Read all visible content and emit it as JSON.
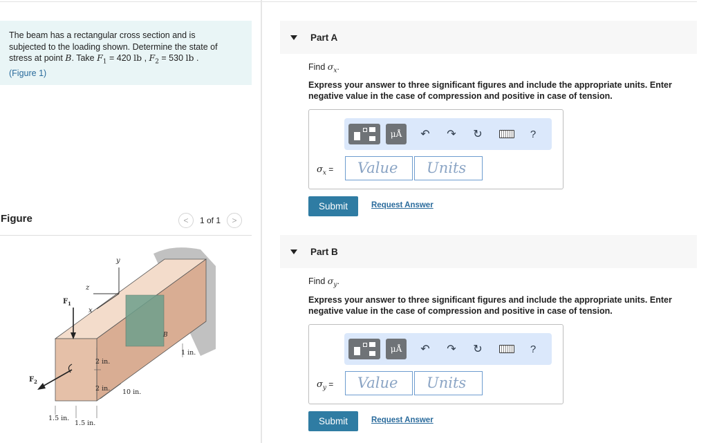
{
  "problem": {
    "line1": "The beam has a rectangular cross section and is",
    "line2": "subjected to the loading shown. Determine the state of",
    "line3_pre": "stress at point ",
    "point": "B",
    "line3_take": ". Take ",
    "f1_sym": "F",
    "f1_sub": "1",
    "f1_val": " = 420 ",
    "f1_unit": "lb",
    "comma": " , ",
    "f2_sym": "F",
    "f2_sub": "2",
    "f2_val": " = 530 ",
    "f2_unit": "lb",
    "period": " .",
    "figure_link": "(Figure 1)"
  },
  "figure_panel": {
    "title": "Figure",
    "prev": "<",
    "counter": "1 of 1",
    "next": ">"
  },
  "figure_labels": {
    "y": "y",
    "z": "z",
    "x": "x",
    "F1": "F",
    "F1_sub": "1",
    "F2": "F",
    "F2_sub": "2",
    "B": "B",
    "one_in": "1 in.",
    "two_in_a": "2 in.",
    "two_in_b": "2 in.",
    "ten_in": "10 in.",
    "one_five_a": "1.5 in.",
    "one_five_b": "1.5 in."
  },
  "toolbar": {
    "units_symbol": "μÅ",
    "undo": "↶",
    "redo": "↷",
    "reset": "↻",
    "help": "?"
  },
  "parts": [
    {
      "title": "Part A",
      "find_pre": "Find ",
      "find_sym": "σ",
      "find_sub": "x",
      "find_post": ".",
      "instruction": "Express your answer to three significant figures and include the appropriate units. Enter negative value in the case of compression and positive in case of tension.",
      "label_sym": "σ",
      "label_sub": "x",
      "label_eq": " =",
      "value_placeholder": "Value",
      "units_placeholder": "Units",
      "submit": "Submit",
      "request": "Request Answer"
    },
    {
      "title": "Part B",
      "find_pre": "Find ",
      "find_sym": "σ",
      "find_sub": "y",
      "find_post": ".",
      "instruction": "Express your answer to three significant figures and include the appropriate units. Enter negative value in the case of compression and positive in case of tension.",
      "label_sym": "σ",
      "label_sub": "y",
      "label_eq": " =",
      "value_placeholder": "Value",
      "units_placeholder": "Units",
      "submit": "Submit",
      "request": "Request Answer"
    }
  ]
}
